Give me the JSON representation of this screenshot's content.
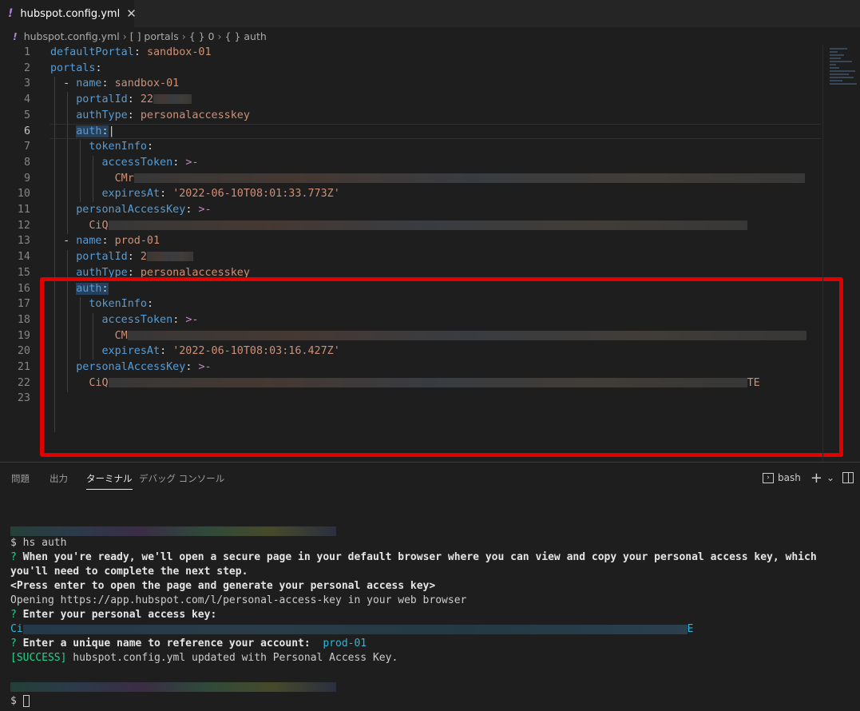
{
  "tab": {
    "title": "hubspot.config.yml",
    "icon": "!",
    "close": "✕"
  },
  "breadcrumb": {
    "file": "hubspot.config.yml",
    "path": [
      "[ ] portals",
      "{ } 0",
      "{ } auth"
    ]
  },
  "editor": {
    "lines": [
      {
        "n": "1"
      },
      {
        "n": "2"
      },
      {
        "n": "3"
      },
      {
        "n": "4"
      },
      {
        "n": "5"
      },
      {
        "n": "6"
      },
      {
        "n": "7"
      },
      {
        "n": "8"
      },
      {
        "n": "9"
      },
      {
        "n": "10"
      },
      {
        "n": "11"
      },
      {
        "n": "12"
      },
      {
        "n": "13"
      },
      {
        "n": "14"
      },
      {
        "n": "15"
      },
      {
        "n": "16"
      },
      {
        "n": "17"
      },
      {
        "n": "18"
      },
      {
        "n": "19"
      },
      {
        "n": "20"
      },
      {
        "n": "21"
      },
      {
        "n": "22"
      },
      {
        "n": "23"
      }
    ],
    "defaultPortal_key": "defaultPortal",
    "defaultPortal_val": "sandbox-01",
    "portals_key": "portals",
    "name_key": "name",
    "sandbox_name": "sandbox-01",
    "portalId_key": "portalId",
    "sandbox_portalId_prefix": "22",
    "authType_key": "authType",
    "authType_val": "personalaccesskey",
    "auth_key": "auth",
    "tokenInfo_key": "tokenInfo",
    "accessToken_key": "accessToken",
    "block_op": ">-",
    "sandbox_token_prefix": "CMr",
    "expiresAt_key": "expiresAt",
    "sandbox_expires": "'2022-06-10T08:01:33.773Z'",
    "personalAccessKey_key": "personalAccessKey",
    "sandbox_pak_prefix": "CiQ",
    "prod_name": "prod-01",
    "prod_portalId_prefix": "2",
    "prod_token_prefix": "CM",
    "prod_expires": "'2022-06-10T08:03:16.427Z'",
    "prod_pak_prefix": "CiQ",
    "prod_pak_suffix": "TE"
  },
  "panel": {
    "tabs": [
      "問題",
      "出力",
      "ターミナル",
      "デバッグ コンソール"
    ],
    "active_tab": "ターミナル",
    "shell": "bash",
    "add": "+",
    "dropdown": "⌄"
  },
  "terminal": {
    "prompt": "$",
    "cmd": "hs auth",
    "q_mark": "?",
    "msg1a": "When you're ready, we'll open a secure page in your default browser where you can view and copy your personal access key, which",
    "msg1b": "you'll need to complete the next step.",
    "msg2": "<Press enter to open the page and generate your personal access key>",
    "msg3": "Opening https://app.hubspot.com/l/personal-access-key in your web browser",
    "msg4": "Enter your personal access key:",
    "key_prefix": "Ci",
    "key_suffix": "E",
    "msg5": "Enter a unique name to reference your account:",
    "account_name": "prod-01",
    "success_tag": "[SUCCESS]",
    "success_msg": "hubspot.config.yml updated with Personal Access Key."
  },
  "colors": {
    "accent_red": "#e00000",
    "key": "#569cd6",
    "string": "#ce9178",
    "success": "#23d18b"
  }
}
